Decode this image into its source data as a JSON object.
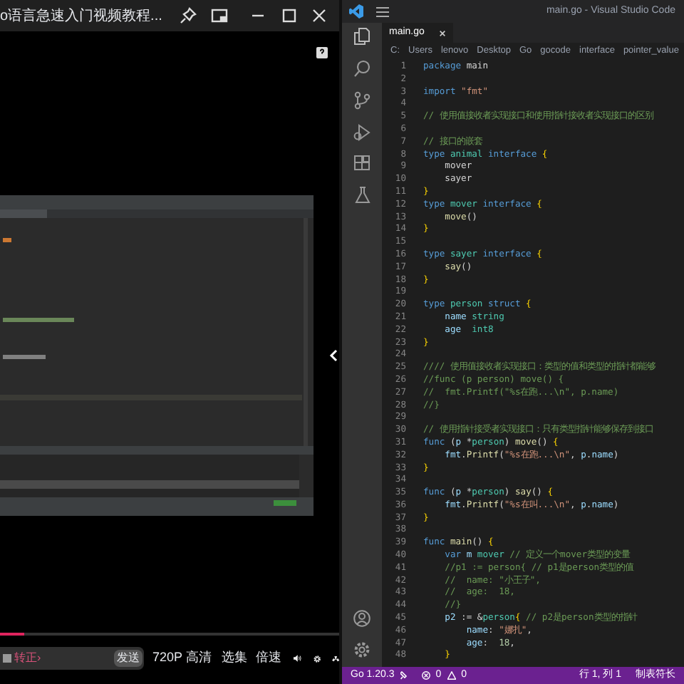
{
  "player": {
    "title": "o语言急速入门视频教程...",
    "progress": {
      "level": 0.07
    },
    "danmaku_input": {
      "placeholder": "转正›"
    },
    "send_button": "发送",
    "quality": "720P 高清",
    "episodes": "选集",
    "speed": "倍速"
  },
  "editor": {
    "window_title": "main.go - Visual Studio Code",
    "tab": {
      "label": "main.go",
      "selected": true
    },
    "breadcrumb": [
      "C:",
      "Users",
      "lenovo",
      "Desktop",
      "Go",
      "gocode",
      "interface",
      "pointer_value"
    ],
    "lines": [
      {
        "number": "1",
        "tokens": [
          {
            "kind": "keyword",
            "text": "package"
          },
          {
            "kind": "plain",
            "text": " main"
          }
        ]
      },
      {
        "number": "2"
      },
      {
        "number": "3",
        "tokens": [
          {
            "kind": "keyword",
            "text": "import"
          },
          {
            "kind": "string",
            "text": " \"fmt\""
          }
        ]
      },
      {
        "number": "4"
      },
      {
        "number": "5",
        "tokens": [
          {
            "kind": "comment",
            "text": "// 使用值接收者实现接口和使用指针接收者实现接口的区别"
          }
        ]
      },
      {
        "number": "6"
      },
      {
        "number": "7",
        "tokens": [
          {
            "kind": "comment",
            "text": "// 接口的嵌套"
          }
        ]
      },
      {
        "number": "8",
        "tokens": [
          {
            "kind": "keyword",
            "text": "type"
          },
          {
            "kind": "type",
            "text": " animal"
          },
          {
            "kind": "keyword",
            "text": " interface"
          },
          {
            "kind": "brace",
            "text": " {"
          }
        ]
      },
      {
        "number": "9",
        "tokens": [
          {
            "kind": "plain",
            "text": "    mover"
          }
        ]
      },
      {
        "number": "10",
        "tokens": [
          {
            "kind": "plain",
            "text": "    sayer"
          }
        ]
      },
      {
        "number": "11",
        "tokens": [
          {
            "kind": "brace",
            "text": "}"
          }
        ]
      },
      {
        "number": "12",
        "tokens": [
          {
            "kind": "keyword",
            "text": "type"
          },
          {
            "kind": "type",
            "text": " mover"
          },
          {
            "kind": "keyword",
            "text": " interface"
          },
          {
            "kind": "brace",
            "text": " {"
          }
        ]
      },
      {
        "number": "13",
        "tokens": [
          {
            "kind": "function",
            "text": "    move"
          },
          {
            "kind": "plain",
            "text": "()"
          }
        ]
      },
      {
        "number": "14",
        "tokens": [
          {
            "kind": "brace",
            "text": "}"
          }
        ]
      },
      {
        "number": "15"
      },
      {
        "number": "16",
        "tokens": [
          {
            "kind": "keyword",
            "text": "type"
          },
          {
            "kind": "type",
            "text": " sayer"
          },
          {
            "kind": "keyword",
            "text": " interface"
          },
          {
            "kind": "brace",
            "text": " {"
          }
        ]
      },
      {
        "number": "17",
        "tokens": [
          {
            "kind": "function",
            "text": "    say"
          },
          {
            "kind": "plain",
            "text": "()"
          }
        ]
      },
      {
        "number": "18",
        "tokens": [
          {
            "kind": "brace",
            "text": "}"
          }
        ]
      },
      {
        "number": "19"
      },
      {
        "number": "20",
        "tokens": [
          {
            "kind": "keyword",
            "text": "type"
          },
          {
            "kind": "type",
            "text": " person"
          },
          {
            "kind": "keyword",
            "text": " struct"
          },
          {
            "kind": "brace",
            "text": " {"
          }
        ]
      },
      {
        "number": "21",
        "tokens": [
          {
            "kind": "variable",
            "text": "    name"
          },
          {
            "kind": "type",
            "text": " string"
          }
        ]
      },
      {
        "number": "22",
        "tokens": [
          {
            "kind": "variable",
            "text": "    age"
          },
          {
            "kind": "type",
            "text": "  int8"
          }
        ]
      },
      {
        "number": "23",
        "tokens": [
          {
            "kind": "brace",
            "text": "}"
          }
        ]
      },
      {
        "number": "24"
      },
      {
        "number": "25",
        "tokens": [
          {
            "kind": "comment",
            "text": "//// 使用值接收者实现接口：类型的值和类型的指针都能够"
          }
        ]
      },
      {
        "number": "26",
        "tokens": [
          {
            "kind": "comment",
            "text": "//func (p person) move() {"
          }
        ]
      },
      {
        "number": "27",
        "tokens": [
          {
            "kind": "comment",
            "text": "//  fmt.Printf(\"%s在跑...\\n\", p.name)"
          }
        ]
      },
      {
        "number": "28",
        "tokens": [
          {
            "kind": "comment",
            "text": "//}"
          }
        ]
      },
      {
        "number": "29"
      },
      {
        "number": "30",
        "tokens": [
          {
            "kind": "comment",
            "text": "// 使用指针接受者实现接口：只有类型指针能够保存到接口"
          }
        ]
      },
      {
        "number": "31",
        "tokens": [
          {
            "kind": "keyword",
            "text": "func"
          },
          {
            "kind": "plain",
            "text": " ("
          },
          {
            "kind": "variable",
            "text": "p"
          },
          {
            "kind": "plain",
            "text": " *"
          },
          {
            "kind": "type",
            "text": "person"
          },
          {
            "kind": "plain",
            "text": ")"
          },
          {
            "kind": "function",
            "text": " move"
          },
          {
            "kind": "plain",
            "text": "()"
          },
          {
            "kind": "brace",
            "text": " {"
          }
        ]
      },
      {
        "number": "32",
        "tokens": [
          {
            "kind": "variable",
            "text": "    fmt"
          },
          {
            "kind": "plain",
            "text": "."
          },
          {
            "kind": "function",
            "text": "Printf"
          },
          {
            "kind": "plain",
            "text": "("
          },
          {
            "kind": "string",
            "text": "\"%s在跑...\\n\""
          },
          {
            "kind": "plain",
            "text": ","
          },
          {
            "kind": "variable",
            "text": " p"
          },
          {
            "kind": "plain",
            "text": "."
          },
          {
            "kind": "variable",
            "text": "name"
          },
          {
            "kind": "plain",
            "text": ")"
          }
        ]
      },
      {
        "number": "33",
        "tokens": [
          {
            "kind": "brace",
            "text": "}"
          }
        ]
      },
      {
        "number": "34"
      },
      {
        "number": "35",
        "tokens": [
          {
            "kind": "keyword",
            "text": "func"
          },
          {
            "kind": "plain",
            "text": " ("
          },
          {
            "kind": "variable",
            "text": "p"
          },
          {
            "kind": "plain",
            "text": " *"
          },
          {
            "kind": "type",
            "text": "person"
          },
          {
            "kind": "plain",
            "text": ")"
          },
          {
            "kind": "function",
            "text": " say"
          },
          {
            "kind": "plain",
            "text": "()"
          },
          {
            "kind": "brace",
            "text": " {"
          }
        ]
      },
      {
        "number": "36",
        "tokens": [
          {
            "kind": "variable",
            "text": "    fmt"
          },
          {
            "kind": "plain",
            "text": "."
          },
          {
            "kind": "function",
            "text": "Printf"
          },
          {
            "kind": "plain",
            "text": "("
          },
          {
            "kind": "string",
            "text": "\"%s在叫...\\n\""
          },
          {
            "kind": "plain",
            "text": ","
          },
          {
            "kind": "variable",
            "text": " p"
          },
          {
            "kind": "plain",
            "text": "."
          },
          {
            "kind": "variable",
            "text": "name"
          },
          {
            "kind": "plain",
            "text": ")"
          }
        ]
      },
      {
        "number": "37",
        "tokens": [
          {
            "kind": "brace",
            "text": "}"
          }
        ]
      },
      {
        "number": "38"
      },
      {
        "number": "39",
        "tokens": [
          {
            "kind": "keyword",
            "text": "func"
          },
          {
            "kind": "function",
            "text": " main"
          },
          {
            "kind": "plain",
            "text": "()"
          },
          {
            "kind": "brace",
            "text": " {"
          }
        ]
      },
      {
        "number": "40",
        "tokens": [
          {
            "kind": "keyword",
            "text": "    var"
          },
          {
            "kind": "variable",
            "text": " m"
          },
          {
            "kind": "type",
            "text": " mover"
          },
          {
            "kind": "comment",
            "text": " // 定义一个mover类型的变量"
          }
        ]
      },
      {
        "number": "41",
        "tokens": [
          {
            "kind": "comment",
            "text": "    //p1 := person{ // p1是person类型的值"
          }
        ]
      },
      {
        "number": "42",
        "tokens": [
          {
            "kind": "comment",
            "text": "    //  name: \"小王子\","
          }
        ]
      },
      {
        "number": "43",
        "tokens": [
          {
            "kind": "comment",
            "text": "    //  age:  18,"
          }
        ]
      },
      {
        "number": "44",
        "tokens": [
          {
            "kind": "comment",
            "text": "    //}"
          }
        ]
      },
      {
        "number": "45",
        "tokens": [
          {
            "kind": "variable",
            "text": "    p2"
          },
          {
            "kind": "plain",
            "text": " := &"
          },
          {
            "kind": "type",
            "text": "person"
          },
          {
            "kind": "brace",
            "text": "{"
          },
          {
            "kind": "comment",
            "text": " // p2是person类型的指针"
          }
        ]
      },
      {
        "number": "46",
        "tokens": [
          {
            "kind": "variable",
            "text": "        name"
          },
          {
            "kind": "plain",
            "text": ":"
          },
          {
            "kind": "string",
            "text": " \"娜扎\""
          },
          {
            "kind": "plain",
            "text": ","
          }
        ]
      },
      {
        "number": "47",
        "tokens": [
          {
            "kind": "variable",
            "text": "        age"
          },
          {
            "kind": "plain",
            "text": ":"
          },
          {
            "kind": "number",
            "text": "  18"
          },
          {
            "kind": "plain",
            "text": ","
          }
        ]
      },
      {
        "number": "48",
        "tokens": [
          {
            "kind": "brace",
            "text": "    }"
          }
        ]
      }
    ],
    "status_bar": {
      "language": "Go 1.20.3",
      "errors": "0",
      "warnings": "0",
      "position": "行 1, 列 1",
      "indent": "制表符长"
    }
  }
}
